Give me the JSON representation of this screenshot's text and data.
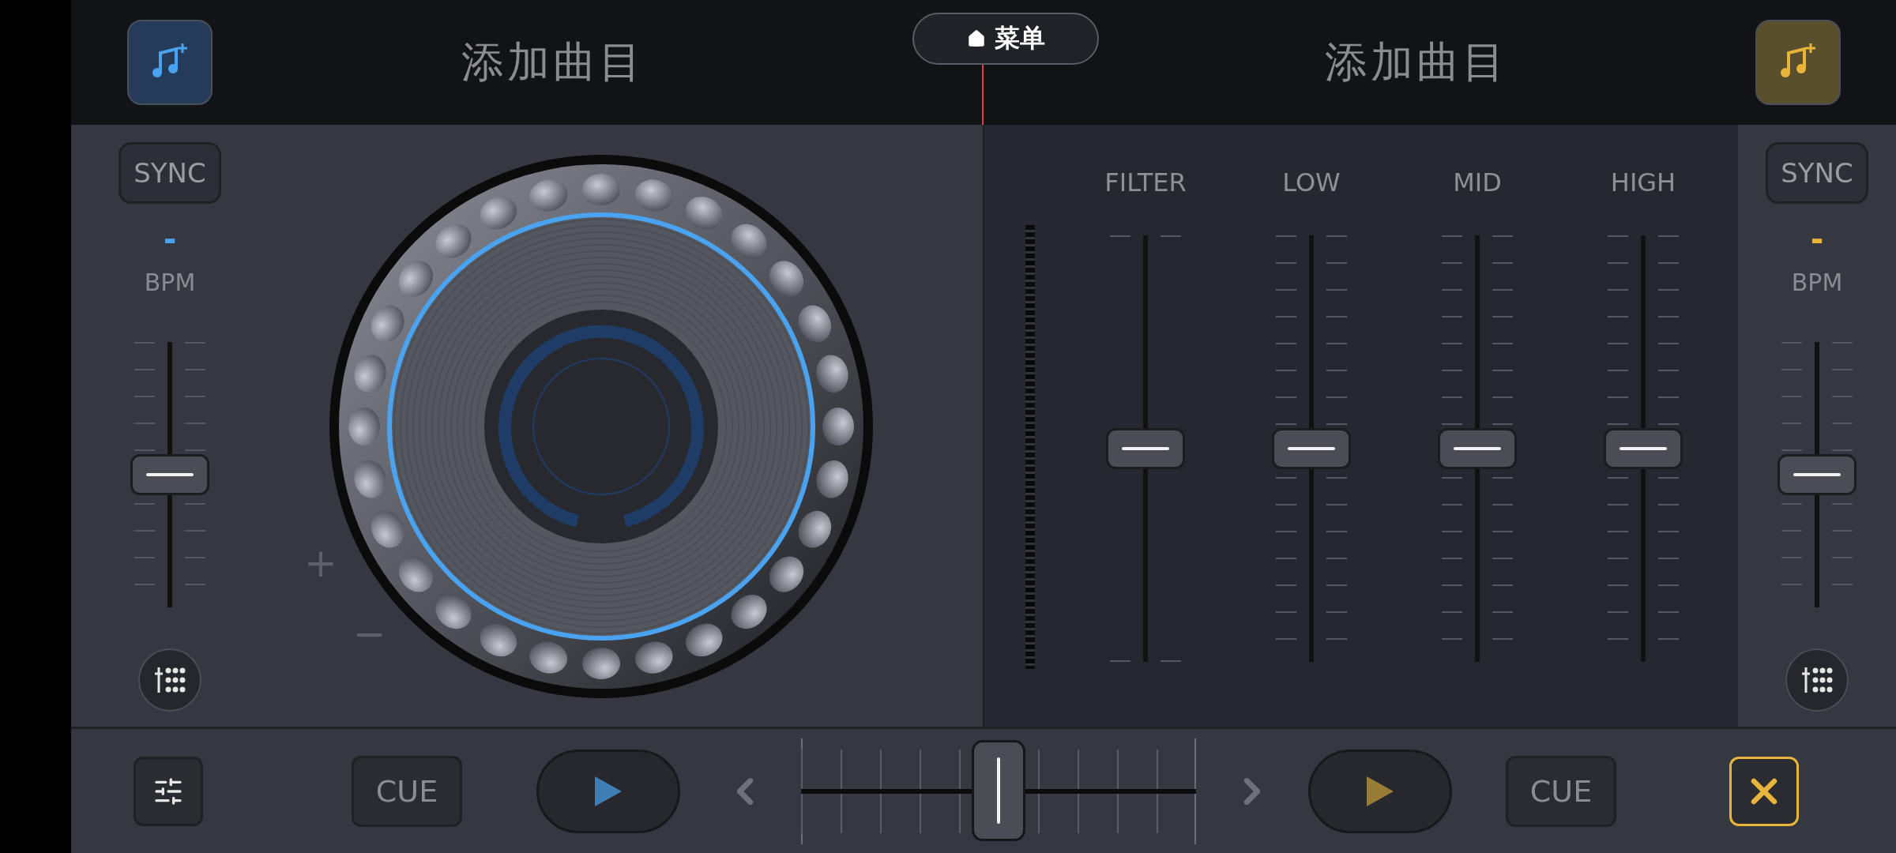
{
  "menu": {
    "label": "菜单"
  },
  "decks": [
    {
      "title": "添加曲目",
      "sync": "SYNC",
      "bpm_value": "-",
      "bpm_label": "BPM",
      "pitch": {
        "level": 0.5
      },
      "color": "#4aa3f0",
      "cue": "CUE"
    },
    {
      "title": "添加曲目",
      "sync": "SYNC",
      "bpm_value": "-",
      "bpm_label": "BPM",
      "pitch": {
        "level": 0.5
      },
      "color": "#e8b53a",
      "cue": "CUE"
    }
  ],
  "nudge": {
    "plus": "+",
    "minus": "−"
  },
  "mixer": {
    "faders": [
      {
        "label": "FILTER",
        "level": 0.5
      },
      {
        "label": "LOW",
        "level": 0.5
      },
      {
        "label": "MID",
        "level": 0.5
      },
      {
        "label": "HIGH",
        "level": 0.5
      }
    ]
  },
  "crossfader": {
    "level": 0.5
  }
}
